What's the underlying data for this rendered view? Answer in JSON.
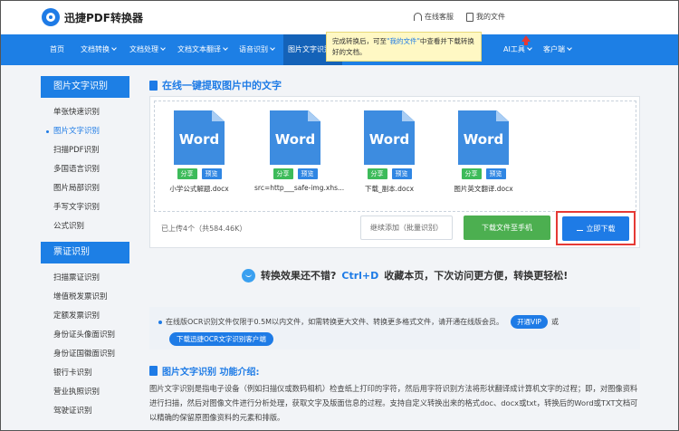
{
  "header": {
    "logo_text": "迅捷PDF转换器",
    "online_service": "在线客服",
    "my_files": "我的文件"
  },
  "nav": {
    "items": [
      {
        "label": "首页",
        "has_arrow": false
      },
      {
        "label": "文档转换",
        "has_arrow": true
      },
      {
        "label": "文档处理",
        "has_arrow": true
      },
      {
        "label": "文档文本翻译",
        "has_arrow": true
      },
      {
        "label": "语音识别",
        "has_arrow": true
      },
      {
        "label": "图片文字识别",
        "has_arrow": true,
        "active": true
      },
      {
        "label": "AI工具",
        "has_arrow": true
      },
      {
        "label": "客户端",
        "has_arrow": true
      }
    ],
    "tooltip_prefix": "完成转换后，可至",
    "tooltip_link": "\"我的文件\"",
    "tooltip_suffix": "中查看并下载转换好的文档。"
  },
  "sidebar": {
    "group1_title": "图片文字识别",
    "group1_items": [
      "单张快速识别",
      "图片文字识别",
      "扫描PDF识别",
      "多国语言识别",
      "图片局部识别",
      "手写文字识别",
      "公式识别"
    ],
    "group2_title": "票证识别",
    "group2_items": [
      "扫描票证识别",
      "增值税发票识别",
      "定额发票识别",
      "身份证头像面识别",
      "身份证国徽面识别",
      "银行卡识别",
      "营业执照识别",
      "驾驶证识别"
    ]
  },
  "main": {
    "section_title": "在线一键提取图片中的文字",
    "files": [
      {
        "icon_text": "Word",
        "name": "小学公式解题.docx",
        "share": "分享",
        "preview": "预览"
      },
      {
        "icon_text": "Word",
        "name": "src=http___safe-img.xhs...",
        "share": "分享",
        "preview": "预览"
      },
      {
        "icon_text": "Word",
        "name": "下载_副本.docx",
        "share": "分享",
        "preview": "预览"
      },
      {
        "icon_text": "Word",
        "name": "图片英文翻译.docx",
        "share": "分享",
        "preview": "预览"
      }
    ],
    "upload_info": "已上传4个（共584.46K）",
    "continue_btn": "继续添加（批量识别）",
    "phone_btn": "下载文件至手机",
    "download_btn": "立即下载",
    "promo_a": "转换效果还不错?",
    "promo_b": "Ctrl+D",
    "promo_c": "收藏本页，下次访问更方便，转换更轻松!",
    "notice_text": "在线版OCR识别文件仅限于0.5M以内文件，如需转换更大文件、转换更多格式文件，请开通在线版会员。",
    "vip_btn": "开通VIP",
    "or_text": "或",
    "client_btn": "下载迅捷OCR文字识别客户端",
    "intro_title": "图片文字识别 功能介绍:",
    "intro_text": "图片文字识别是指电子设备（例如扫描仪或数码相机）检查纸上打印的字符，然后用字符识别方法将形状翻译成计算机文字的过程；即，对图像资料进行扫描，然后对图像文件进行分析处理，获取文字及版面信息的过程。支持自定义转换出来的格式doc、docx或txt，转换后的Word或TXT文档可以精确的保留原图像资料的元素和排版。"
  },
  "colors": {
    "brand": "#1d7fe5",
    "highlight_box": "#e53935",
    "green": "#4caf50"
  }
}
